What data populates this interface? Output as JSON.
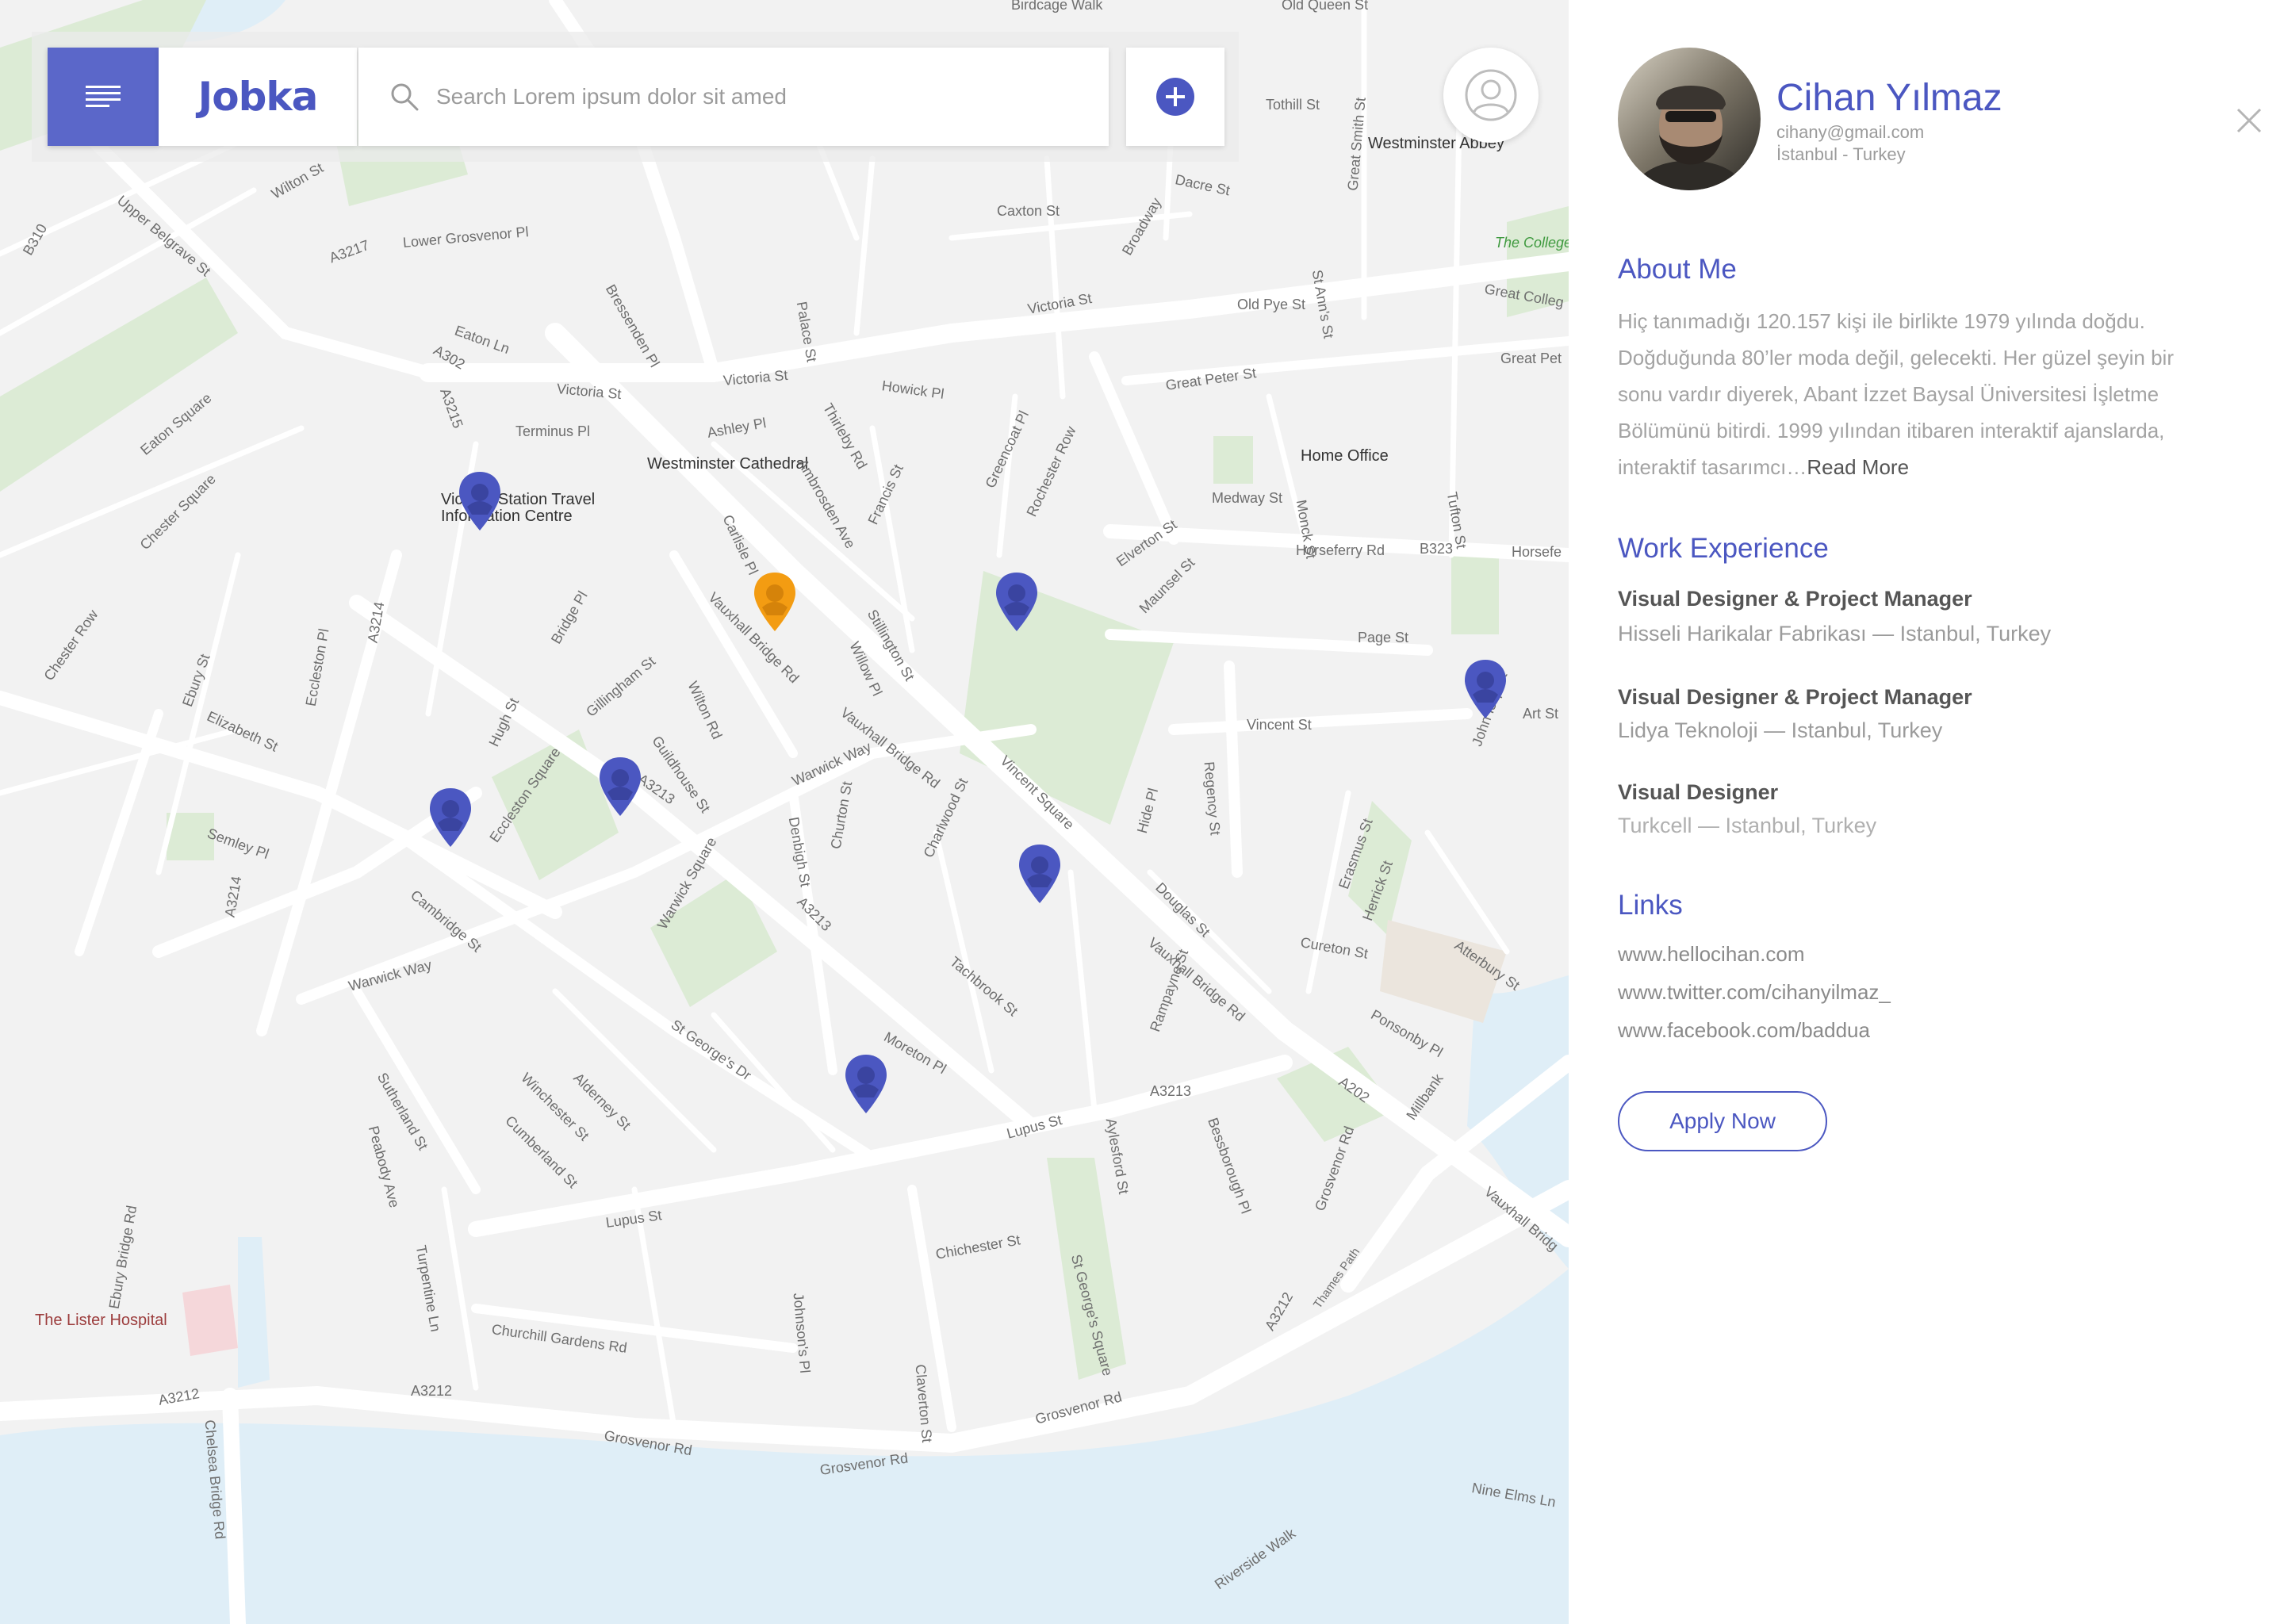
{
  "app": {
    "logo": "Jobka",
    "search_placeholder": "Search Lorem ipsum dolor sit amed"
  },
  "icons": {
    "menu": "menu-icon",
    "search": "search-icon",
    "add": "plus-circle-icon",
    "user": "user-icon",
    "close": "close-icon",
    "pin": "location-pin-icon"
  },
  "colors": {
    "brand": "#5b67c9",
    "pin_default": "#4b57c1",
    "pin_selected": "#f39c12",
    "map_bg": "#f2f2f2",
    "water": "#dfeef7",
    "park": "#dcebd5"
  },
  "map": {
    "labels": {
      "birdcage_walk": "Birdcage Walk",
      "old_queen_st": "Old Queen St",
      "tothill_st": "Tothill St",
      "westminster_abbey": "Westminster Abbey",
      "dacre_st": "Dacre St",
      "caxton_st": "Caxton St",
      "broadway": "Broadway",
      "palace_st": "Palace St",
      "wilton_st": "Wilton St",
      "upper_belgrave_st": "Upper Belgrave St",
      "lower_grosvenor_pl": "Lower Grosvenor Pl",
      "bressenden_pl": "Bressenden Pl",
      "victoria_st_1": "Victoria St",
      "victoria_st_2": "Victoria St",
      "victoria_st_3": "Victoria St",
      "howick_pl": "Howick Pl",
      "old_pye_st": "Old Pye St",
      "great_peter_st": "Great Peter St",
      "the_college_garden": "The College Garden",
      "great_college": "Great Colleg",
      "great_pet": "Great Pet",
      "eaton_ln": "Eaton Ln",
      "ashley_pl": "Ashley Pl",
      "terminus_pl": "Terminus Pl",
      "westminster_cathedral": "Westminster Cathedral",
      "home_office": "Home Office",
      "medway_st": "Medway St",
      "horseferry_rd": "Horseferry Rd",
      "horsefe": "Horsefe",
      "b323": "B323",
      "victoria_station": "Victoria Station Travel Information Centre",
      "elverton_st": "Elverton St",
      "maunsel_st": "Maunsel St",
      "page_st": "Page St",
      "vincent_st": "Vincent St",
      "art_st": "Art St",
      "vauxhall_bridge_rd_1": "Vauxhall Bridge Rd",
      "vauxhall_bridge_rd_2": "Vauxhall Bridge Rd",
      "vauxhall_bridge_rd_3": "Vauxhall Bridge Rd",
      "warwick_way_1": "Warwick Way",
      "warwick_way_2": "Warwick Way",
      "vincent_square": "Vincent Square",
      "eccleston_square": "Eccleston Square",
      "a3213_1": "A3213",
      "a3213_2": "A3213",
      "a3213_3": "A3213",
      "douglas_st": "Douglas St",
      "erasmus_st": "Erasmus St",
      "herrick_st": "Herrick St",
      "cureton_st": "Cureton St",
      "atterbury_st": "Atterbury St",
      "ponsonby_pl": "Ponsonby Pl",
      "millbank": "Millbank",
      "a202": "A202",
      "rampayne_st": "Rampayne St",
      "tachbrook_st": "Tachbrook St",
      "moreton_pl": "Moreton Pl",
      "lupus_st_1": "Lupus St",
      "lupus_st_2": "Lupus St",
      "chichester_st": "Chichester St",
      "st_georges_square": "St George's Square",
      "grosvenor_rd_1": "Grosvenor Rd",
      "grosvenor_rd_2": "Grosvenor Rd",
      "grosvenor_rd_3": "Grosvenor Rd",
      "grosvenor_rd_4": "Grosvenor Rd",
      "a3212_1": "A3212",
      "a3212_2": "A3212",
      "a3212_3": "A3212",
      "chelsea_bridge_rd": "Chelsea Bridge Rd",
      "the_lister_hospital": "The Lister Hospital",
      "churchill_gardens_rd": "Churchill Gardens Rd",
      "nine_elms_ln": "Nine Elms Ln",
      "riverside_walk": "Riverside Walk",
      "ebury_bridge_rd": "Ebury Bridge Rd",
      "cambridge_st": "Cambridge St",
      "semley_pl": "Semley Pl",
      "elizabeth_st": "Elizabeth St",
      "chester_row": "Chester Row",
      "a3214_1": "A3214",
      "a3214_2": "A3214",
      "sutherland_st": "Sutherland St",
      "denbigh_st": "Denbigh St",
      "churton_st": "Churton St",
      "charlwood_st": "Charlwood St",
      "a3215": "A3215",
      "a302": "A302",
      "a3217": "A3217",
      "b310": "B310",
      "gillingham_st": "Gillingham St",
      "wilton_rd": "Wilton Rd",
      "guildhouse_st": "Guildhouse St",
      "hugh_st": "Hugh St",
      "bridge_pl": "Bridge Pl",
      "eccleston_pl": "Eccleston Pl",
      "ebury_st": "Ebury St",
      "winchester_st": "Winchester St",
      "cumberland_st": "Cumberland St",
      "st_georges_dr": "St George's Dr",
      "johnsons_pl": "Johnson's Pl",
      "claverton_st": "Claverton St",
      "aylesford_st": "Aylesford St",
      "bessborough_pl": "Bessborough Pl",
      "thames_path": "Thames Path",
      "vauxhall_bridg": "Vauxhall Bridg",
      "rochester_row": "Rochester Row",
      "greencoat_pl": "Greencoat Pl",
      "francis_st": "Francis St",
      "ambrosden_ave": "Ambrosden Ave",
      "thirleby_rd": "Thirleby Rd",
      "stillington_st": "Stillington St",
      "carlisle_pl": "Carlisle Pl",
      "eaton_square": "Eaton Square",
      "chester_square": "Chester Square",
      "regency_st": "Regency St",
      "hide_pl": "Hide Pl",
      "turpentine_ln": "Turpentine Ln",
      "peabody_ave": "Peabody Ave",
      "alderney_st": "Alderney St",
      "warwick_square": "Warwick Square",
      "monck_st": "Monck St",
      "tufton_st": "Tufton St",
      "great_smith_st": "Great Smith St",
      "john_islip_st": "John Islip St",
      "willow_pl": "Willow Pl",
      "st_anns_st": "St Ann's St"
    }
  },
  "profile": {
    "name": "Cihan Yılmaz",
    "email": "cihany@gmail.com",
    "location": "İstanbul - Turkey",
    "about_title": "About Me",
    "about_text": "Hiç tanımadığı 120.157 kişi ile birlikte 1979 yılında doğdu. Doğduğunda 80’ler moda değil, gelecekti. Her güzel şeyin bir sonu vardır diyerek, Abant İzzet Baysal Üniversitesi İşletme Bölümünü bitirdi. 1999 yılından itibaren interaktif ajanslarda, interaktif tasarımcı…",
    "read_more": "Read More",
    "work_title": "Work Experience",
    "jobs": [
      {
        "title": "Visual Designer & Project Manager",
        "company": "Hisseli Harikalar Fabrikası — Istanbul, Turkey"
      },
      {
        "title": "Visual Designer & Project Manager",
        "company": "Lidya Teknoloji — Istanbul, Turkey"
      },
      {
        "title": "Visual Designer",
        "company": "Turkcell — Istanbul, Turkey"
      }
    ],
    "links_title": "Links",
    "links": [
      "www.hellocihan.com",
      "www.twitter.com/cihanyilmaz_",
      "www.facebook.com/baddua"
    ],
    "apply_label": "Apply Now"
  }
}
